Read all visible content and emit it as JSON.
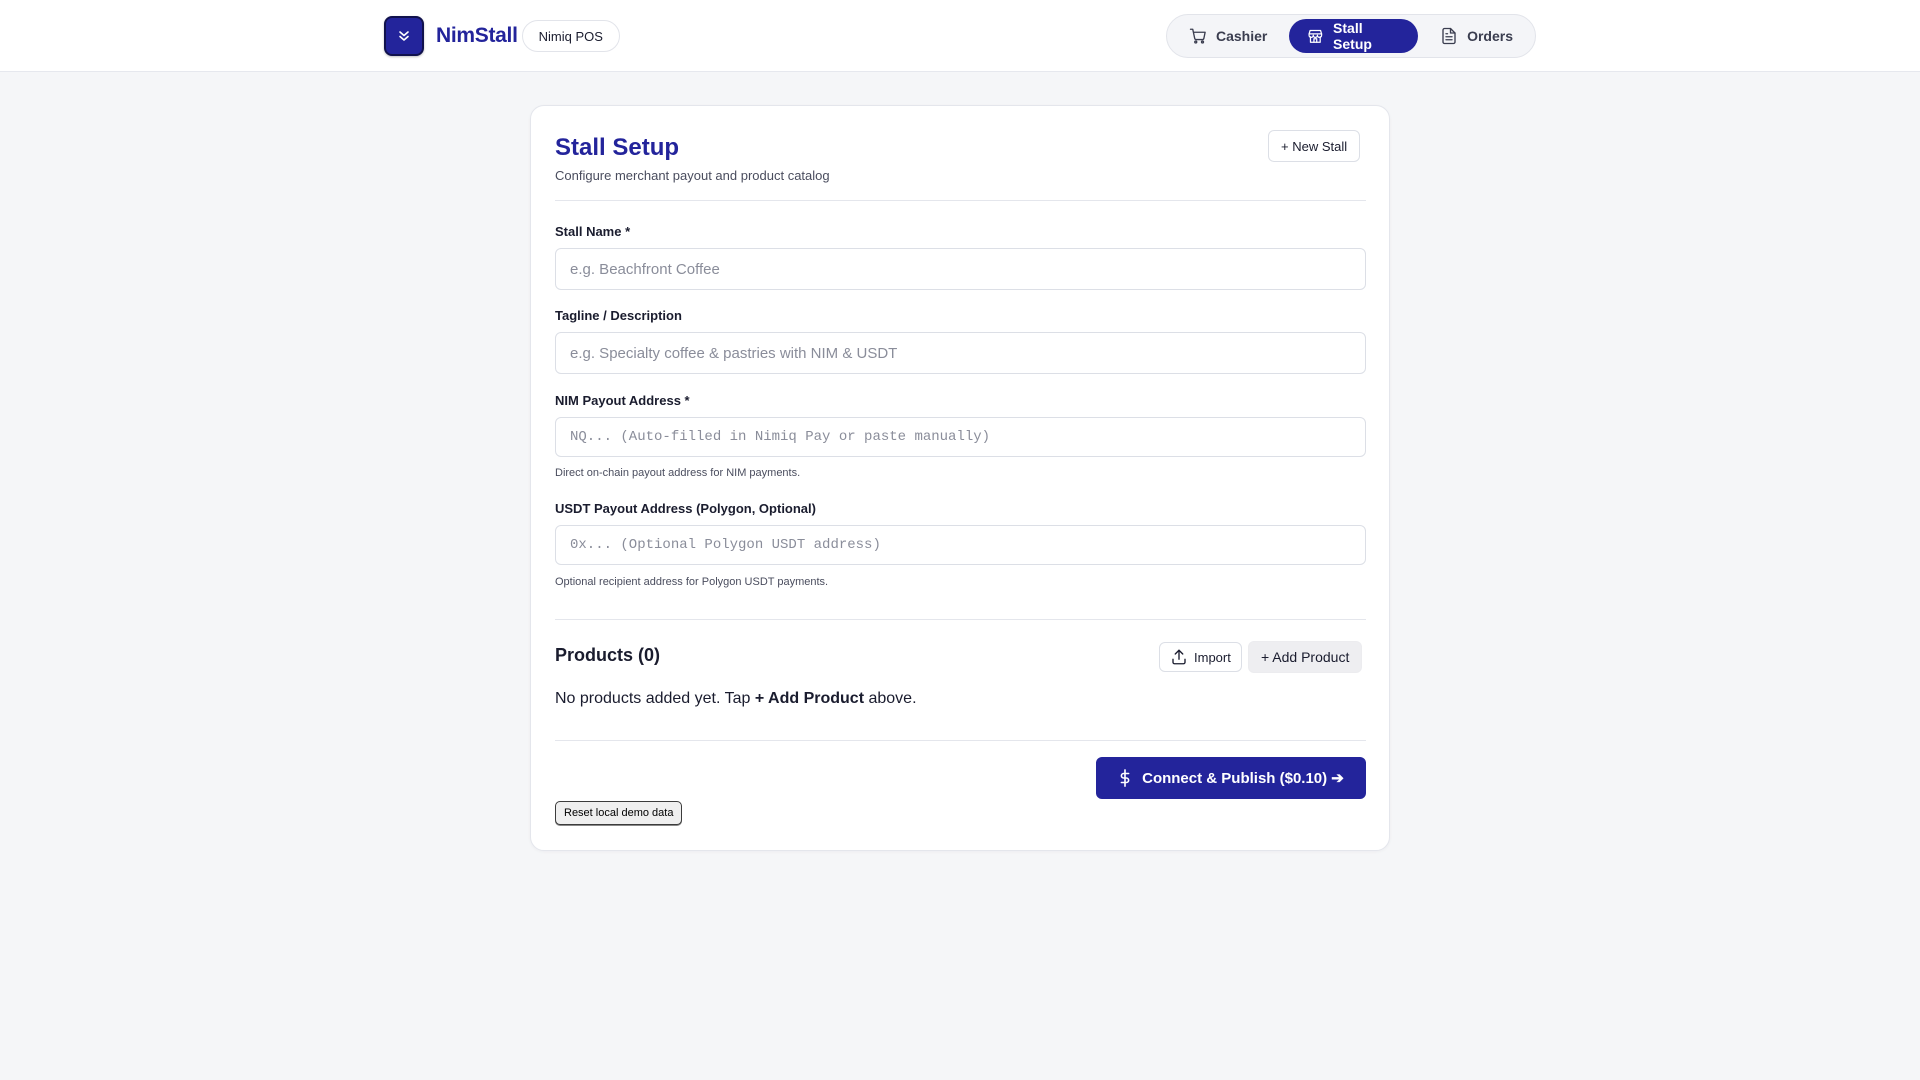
{
  "brand": {
    "name": "NimStall",
    "pill": "Nimiq POS"
  },
  "nav": {
    "items": [
      {
        "label": "Cashier",
        "icon": "cart-icon",
        "active": false
      },
      {
        "label": "Stall Setup",
        "icon": "store-icon",
        "active": true
      },
      {
        "label": "Orders",
        "icon": "document-icon",
        "active": false
      }
    ]
  },
  "setup": {
    "title": "Stall Setup",
    "subtitle": "Configure merchant payout and product catalog",
    "new_stall_label": "+ New Stall",
    "fields": {
      "stall_name": {
        "label": "Stall Name *",
        "placeholder": "e.g. Beachfront Coffee",
        "value": ""
      },
      "tagline": {
        "label": "Tagline / Description",
        "placeholder": "e.g. Specialty coffee & pastries with NIM & USDT",
        "value": ""
      },
      "nim_address": {
        "label": "NIM Payout Address *",
        "placeholder": "NQ... (Auto-filled in Nimiq Pay or paste manually)",
        "value": "",
        "hint": "Direct on-chain payout address for NIM payments."
      },
      "usdt_address": {
        "label": "USDT Payout Address (Polygon, Optional)",
        "placeholder": "0x... (Optional Polygon USDT address)",
        "value": "",
        "hint": "Optional recipient address for Polygon USDT payments."
      }
    }
  },
  "products": {
    "title": "Products (0)",
    "import_label": "Import",
    "add_label": "+ Add Product",
    "empty_prefix": "No products added yet. Tap ",
    "empty_bold": "+ Add Product",
    "empty_suffix": " above."
  },
  "actions": {
    "publish_label": "Connect & Publish ($0.10) ➔",
    "reset_label": "Reset local demo data"
  },
  "colors": {
    "accent": "#23249b",
    "background": "#f5f6f8"
  }
}
